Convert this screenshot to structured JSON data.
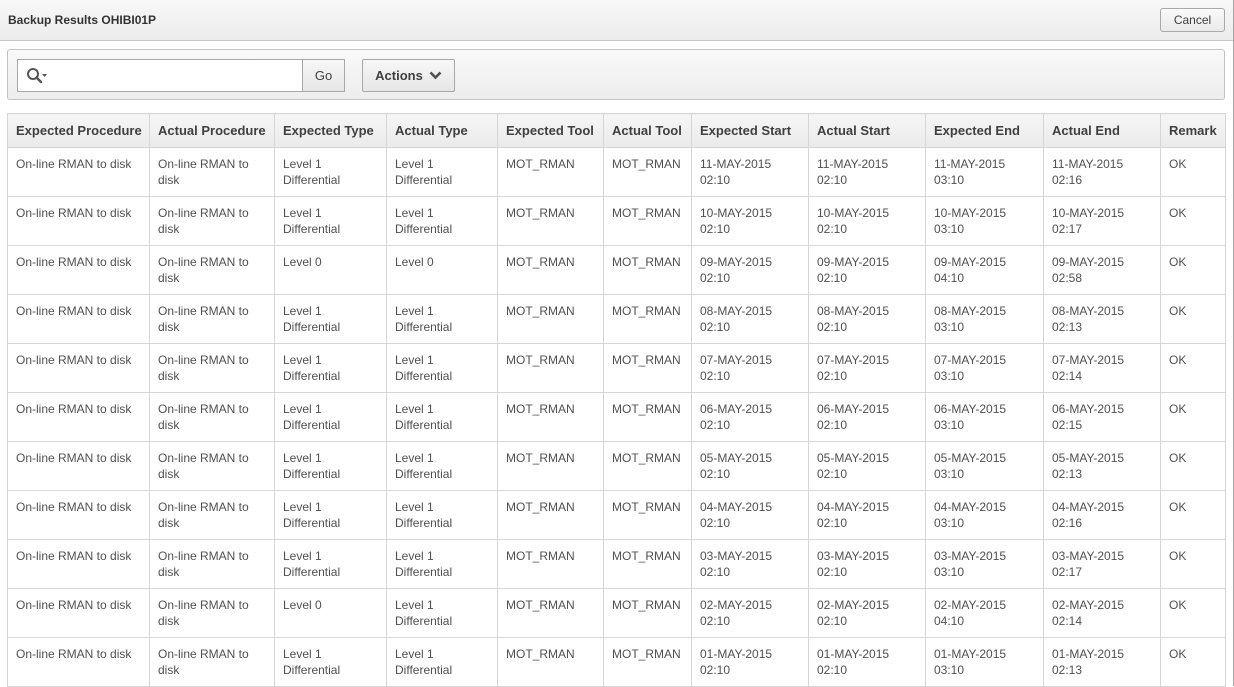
{
  "dialog": {
    "title": "Backup Results OHIBI01P",
    "cancel_label": "Cancel"
  },
  "toolbar": {
    "search_value": "",
    "search_placeholder": "",
    "go_label": "Go",
    "actions_label": "Actions",
    "icons": {
      "search": "search-icon",
      "search_dropdown": "caret-down-icon",
      "actions_dropdown": "chevron-down-icon"
    }
  },
  "table": {
    "columns": [
      "Expected Procedure",
      "Actual Procedure",
      "Expected Type",
      "Actual Type",
      "Expected Tool",
      "Actual Tool",
      "Expected Start",
      "Actual Start",
      "Expected End",
      "Actual End",
      "Remark"
    ],
    "rows": [
      [
        "On-line RMAN to disk",
        "On-line RMAN to disk",
        "Level 1 Differential",
        "Level 1 Differential",
        "MOT_RMAN",
        "MOT_RMAN",
        "11-MAY-2015 02:10",
        "11-MAY-2015 02:10",
        "11-MAY-2015 03:10",
        "11-MAY-2015 02:16",
        "OK"
      ],
      [
        "On-line RMAN to disk",
        "On-line RMAN to disk",
        "Level 1 Differential",
        "Level 1 Differential",
        "MOT_RMAN",
        "MOT_RMAN",
        "10-MAY-2015 02:10",
        "10-MAY-2015 02:10",
        "10-MAY-2015 03:10",
        "10-MAY-2015 02:17",
        "OK"
      ],
      [
        "On-line RMAN to disk",
        "On-line RMAN to disk",
        "Level 0",
        "Level 0",
        "MOT_RMAN",
        "MOT_RMAN",
        "09-MAY-2015 02:10",
        "09-MAY-2015 02:10",
        "09-MAY-2015 04:10",
        "09-MAY-2015 02:58",
        "OK"
      ],
      [
        "On-line RMAN to disk",
        "On-line RMAN to disk",
        "Level 1 Differential",
        "Level 1 Differential",
        "MOT_RMAN",
        "MOT_RMAN",
        "08-MAY-2015 02:10",
        "08-MAY-2015 02:10",
        "08-MAY-2015 03:10",
        "08-MAY-2015 02:13",
        "OK"
      ],
      [
        "On-line RMAN to disk",
        "On-line RMAN to disk",
        "Level 1 Differential",
        "Level 1 Differential",
        "MOT_RMAN",
        "MOT_RMAN",
        "07-MAY-2015 02:10",
        "07-MAY-2015 02:10",
        "07-MAY-2015 03:10",
        "07-MAY-2015 02:14",
        "OK"
      ],
      [
        "On-line RMAN to disk",
        "On-line RMAN to disk",
        "Level 1 Differential",
        "Level 1 Differential",
        "MOT_RMAN",
        "MOT_RMAN",
        "06-MAY-2015 02:10",
        "06-MAY-2015 02:10",
        "06-MAY-2015 03:10",
        "06-MAY-2015 02:15",
        "OK"
      ],
      [
        "On-line RMAN to disk",
        "On-line RMAN to disk",
        "Level 1 Differential",
        "Level 1 Differential",
        "MOT_RMAN",
        "MOT_RMAN",
        "05-MAY-2015 02:10",
        "05-MAY-2015 02:10",
        "05-MAY-2015 03:10",
        "05-MAY-2015 02:13",
        "OK"
      ],
      [
        "On-line RMAN to disk",
        "On-line RMAN to disk",
        "Level 1 Differential",
        "Level 1 Differential",
        "MOT_RMAN",
        "MOT_RMAN",
        "04-MAY-2015 02:10",
        "04-MAY-2015 02:10",
        "04-MAY-2015 03:10",
        "04-MAY-2015 02:16",
        "OK"
      ],
      [
        "On-line RMAN to disk",
        "On-line RMAN to disk",
        "Level 1 Differential",
        "Level 1 Differential",
        "MOT_RMAN",
        "MOT_RMAN",
        "03-MAY-2015 02:10",
        "03-MAY-2015 02:10",
        "03-MAY-2015 03:10",
        "03-MAY-2015 02:17",
        "OK"
      ],
      [
        "On-line RMAN to disk",
        "On-line RMAN to disk",
        "Level 0",
        "Level 1 Differential",
        "MOT_RMAN",
        "MOT_RMAN",
        "02-MAY-2015 02:10",
        "02-MAY-2015 02:10",
        "02-MAY-2015 04:10",
        "02-MAY-2015 02:14",
        "OK"
      ],
      [
        "On-line RMAN to disk",
        "On-line RMAN to disk",
        "Level 1 Differential",
        "Level 1 Differential",
        "MOT_RMAN",
        "MOT_RMAN",
        "01-MAY-2015 02:10",
        "01-MAY-2015 02:10",
        "01-MAY-2015 03:10",
        "01-MAY-2015 02:13",
        "OK"
      ]
    ]
  }
}
